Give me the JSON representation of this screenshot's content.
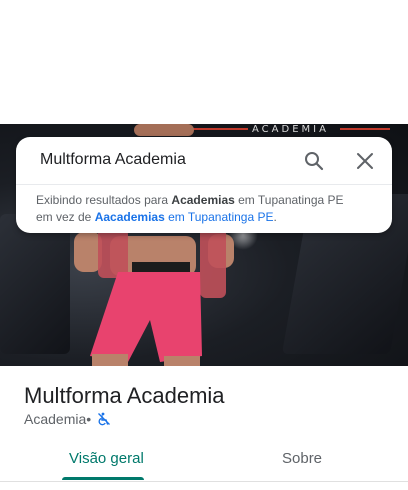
{
  "search": {
    "query": "Multforma Academia"
  },
  "notice": {
    "showing_prefix": "Exibindo resultados para ",
    "showing_term": "Academias",
    "showing_suffix": " em Tupanatinga PE",
    "instead_prefix": "em vez de ",
    "instead_term": "Aacademias",
    "instead_suffix": " em Tupanatinga PE",
    "end": "."
  },
  "hero": {
    "sign_text": "ACADEMIA"
  },
  "place": {
    "name": "Multforma Academia",
    "category": "Academia",
    "separator": " •"
  },
  "tabs": [
    {
      "label": "Visão geral"
    },
    {
      "label": "Sobre"
    }
  ],
  "colors": {
    "accent": "#00796b",
    "link": "#1a73e8",
    "accessibility_icon": "#1a73e8"
  },
  "icons": {
    "search": "search-icon",
    "close": "close-icon",
    "accessibility": "no-wheelchair-access-icon"
  }
}
